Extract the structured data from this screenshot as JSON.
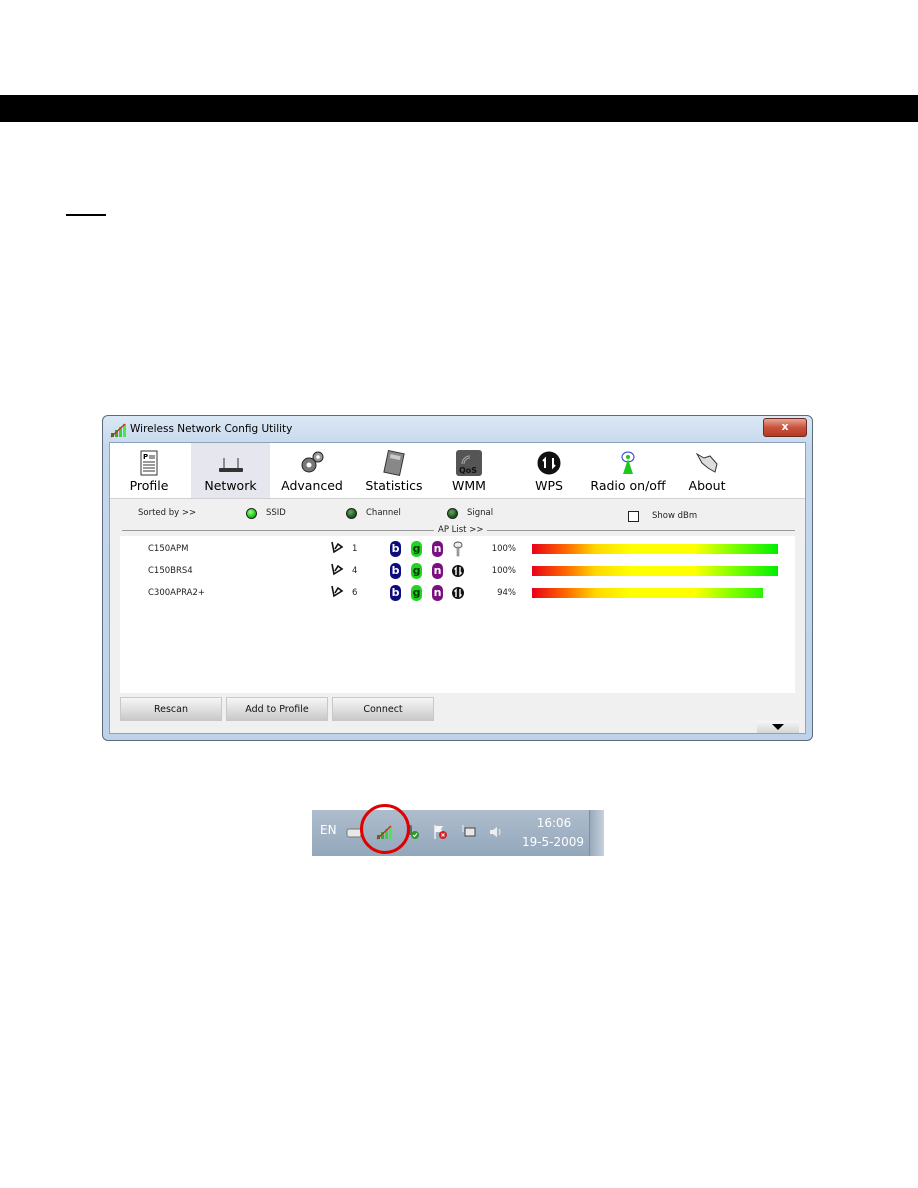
{
  "window": {
    "title": "Wireless Network Config Utility",
    "close_label": "x"
  },
  "toolbar": {
    "items": [
      {
        "label": "Profile",
        "icon": "profile-icon",
        "selected": false
      },
      {
        "label": "Network",
        "icon": "router-icon",
        "selected": true
      },
      {
        "label": "Advanced",
        "icon": "gears-icon",
        "selected": false
      },
      {
        "label": "Statistics",
        "icon": "calculator-icon",
        "selected": false
      },
      {
        "label": "WMM",
        "icon": "qos-icon",
        "selected": false
      },
      {
        "label": "WPS",
        "icon": "wps-icon",
        "selected": false
      },
      {
        "label": "Radio on/off",
        "icon": "antenna-icon",
        "selected": false
      },
      {
        "label": "About",
        "icon": "about-icon",
        "selected": false
      }
    ],
    "wmm_icon_text": "QoS"
  },
  "sort": {
    "label": "Sorted by >>",
    "options": [
      {
        "label": "SSID",
        "selected": true
      },
      {
        "label": "Channel",
        "selected": false
      },
      {
        "label": "Signal",
        "selected": false
      }
    ],
    "show_dbm_label": "Show dBm",
    "show_dbm_checked": false,
    "ap_list_label": "AP List >>"
  },
  "ap_list": [
    {
      "ssid": "C150APM",
      "channel": "1",
      "modes": [
        "b",
        "g",
        "n"
      ],
      "security": "key",
      "signal_text": "100%",
      "signal": 100
    },
    {
      "ssid": "C150BRS4",
      "channel": "4",
      "modes": [
        "b",
        "g",
        "n"
      ],
      "security": "wps",
      "signal_text": "100%",
      "signal": 100
    },
    {
      "ssid": "C300APRA2+",
      "channel": "6",
      "modes": [
        "b",
        "g",
        "n"
      ],
      "security": "wps",
      "signal_text": "94%",
      "signal": 94
    }
  ],
  "buttons": {
    "rescan": "Rescan",
    "add_to_profile": "Add to Profile",
    "connect": "Connect"
  },
  "tray": {
    "language": "EN",
    "time": "16:06",
    "date": "19-5-2009"
  },
  "colors": {
    "close_button": "#c9523d",
    "badge_b": "#0c0c7c",
    "badge_g": "#1fd51f",
    "badge_n": "#7a1080",
    "highlight_ring": "#e00000"
  }
}
